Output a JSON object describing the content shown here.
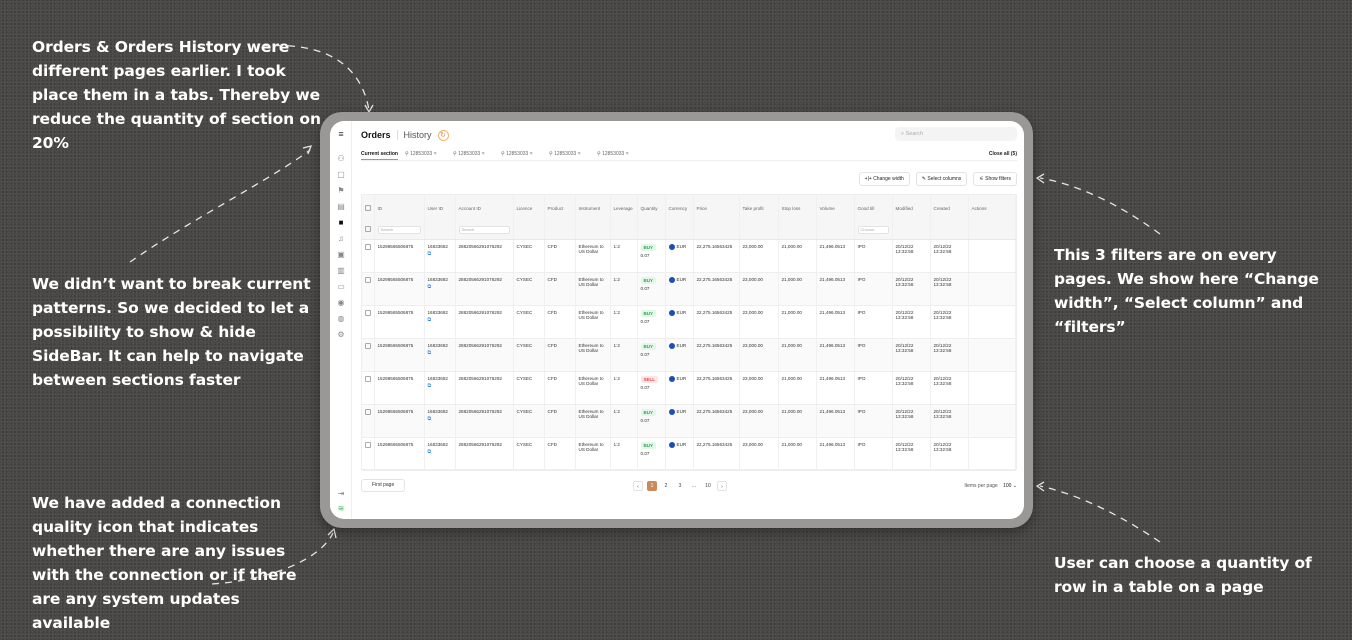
{
  "annotations": {
    "tabs_note": "Orders & Orders History were different pages earlier. I took place them in a tabs. Thereby we reduce the quantity of section on 20%",
    "sidebar_note": "We didn’t want to break current patterns. So we decided to let a possibility to show & hide SideBar. It can help to navigate between sections faster",
    "connection_note": "We have added a connection quality icon that indicates whether there are any issues with the connection or if there are any system updates available",
    "filters_note": "This 3 filters are on every pages. We show here “Change width”, “Select column” and “filters”",
    "rows_note": "User can choose a quantity of row in a table on a page"
  },
  "header": {
    "tab_orders": "Orders",
    "tab_history": "History",
    "refresh_icon": "↻",
    "search_placeholder": "Search"
  },
  "section_tabs": {
    "items": [
      "Current section",
      "12853033",
      "12853033",
      "12853033",
      "12853033",
      "12853033"
    ],
    "close_all": "Close all (5)"
  },
  "toolbar": {
    "change_width": "+|+ Change width",
    "select_columns": "Select columns",
    "show_filters": "Show filters"
  },
  "table": {
    "columns": [
      "ID",
      "User ID",
      "Account ID",
      "Licence",
      "Product",
      "Instrument",
      "Leverage",
      "Quantity",
      "Currency",
      "Price",
      "Take profit",
      "Stop loss",
      "Volume",
      "Good till",
      "Modified",
      "Created",
      "Actions"
    ],
    "filter_placeholder": "Search",
    "filter_choose": "Choose",
    "rows": [
      {
        "id": "15298565506875",
        "user": "16833682",
        "account": "28820566291076292",
        "licence": "CYSEC",
        "product": "CFD",
        "instrument": "Ethereum to US Dollar",
        "leverage": "1:2",
        "side": "BUY",
        "qty": "0.07",
        "currency": "EUR",
        "price": "22,275.16563425",
        "tp": "23,000.00",
        "sl": "21,000.00",
        "volume": "21,496.0513",
        "good": "IPO",
        "modified": "20/12/22 13:32:58",
        "created": "20/12/22 13:32:58"
      },
      {
        "id": "15298565506875",
        "user": "16833682",
        "account": "28820566291076292",
        "licence": "CYSEC",
        "product": "CFD",
        "instrument": "Ethereum to US Dollar",
        "leverage": "1:2",
        "side": "BUY",
        "qty": "0.07",
        "currency": "EUR",
        "price": "22,275.16563425",
        "tp": "23,000.00",
        "sl": "21,000.00",
        "volume": "21,496.0513",
        "good": "IPO",
        "modified": "20/12/22 13:32:58",
        "created": "20/12/22 13:32:58"
      },
      {
        "id": "15298565506875",
        "user": "16833682",
        "account": "28820566291076292",
        "licence": "CYSEC",
        "product": "CFD",
        "instrument": "Ethereum to US Dollar",
        "leverage": "1:2",
        "side": "BUY",
        "qty": "0.07",
        "currency": "EUR",
        "price": "22,275.16563425",
        "tp": "23,000.00",
        "sl": "21,000.00",
        "volume": "21,496.0513",
        "good": "IPO",
        "modified": "20/12/22 13:32:58",
        "created": "20/12/22 13:32:58"
      },
      {
        "id": "15298565506875",
        "user": "16833682",
        "account": "28820566291076292",
        "licence": "CYSEC",
        "product": "CFD",
        "instrument": "Ethereum to US Dollar",
        "leverage": "1:2",
        "side": "BUY",
        "qty": "0.07",
        "currency": "EUR",
        "price": "22,275.16563425",
        "tp": "23,000.00",
        "sl": "21,000.00",
        "volume": "21,496.0513",
        "good": "IPO",
        "modified": "20/12/22 13:32:58",
        "created": "20/12/22 13:32:58"
      },
      {
        "id": "15298565506875",
        "user": "16833682",
        "account": "28820566291076292",
        "licence": "CYSEC",
        "product": "CFD",
        "instrument": "Ethereum to US Dollar",
        "leverage": "1:2",
        "side": "SELL",
        "qty": "0.07",
        "currency": "EUR",
        "price": "22,275.16563425",
        "tp": "23,000.00",
        "sl": "21,000.00",
        "volume": "21,496.0513",
        "good": "IPO",
        "modified": "20/12/22 13:32:58",
        "created": "20/12/22 13:32:58"
      },
      {
        "id": "15298565506875",
        "user": "16833682",
        "account": "28820566291076292",
        "licence": "CYSEC",
        "product": "CFD",
        "instrument": "Ethereum to US Dollar",
        "leverage": "1:2",
        "side": "BUY",
        "qty": "0.07",
        "currency": "EUR",
        "price": "22,275.16563425",
        "tp": "23,000.00",
        "sl": "21,000.00",
        "volume": "21,496.0513",
        "good": "IPO",
        "modified": "20/12/22 13:32:58",
        "created": "20/12/22 13:32:58"
      },
      {
        "id": "15298565506875",
        "user": "16833682",
        "account": "28820566291076292",
        "licence": "CYSEC",
        "product": "CFD",
        "instrument": "Ethereum to US Dollar",
        "leverage": "1:2",
        "side": "BUY",
        "qty": "0.07",
        "currency": "EUR",
        "price": "22,275.16563425",
        "tp": "23,000.00",
        "sl": "21,000.00",
        "volume": "21,496.0513",
        "good": "IPO",
        "modified": "20/12/22 13:32:58",
        "created": "20/12/22 13:32:58"
      }
    ]
  },
  "footer": {
    "first_page": "First page",
    "pages": [
      "1",
      "2",
      "3",
      "...",
      "10"
    ],
    "current_page": "1",
    "items_per_page_label": "Items per page",
    "items_per_page_value": "100"
  },
  "colors": {
    "accent": "#c98b5a",
    "buy": "#2fa653",
    "sell": "#e04646",
    "connection_ok": "#2fb85a"
  }
}
